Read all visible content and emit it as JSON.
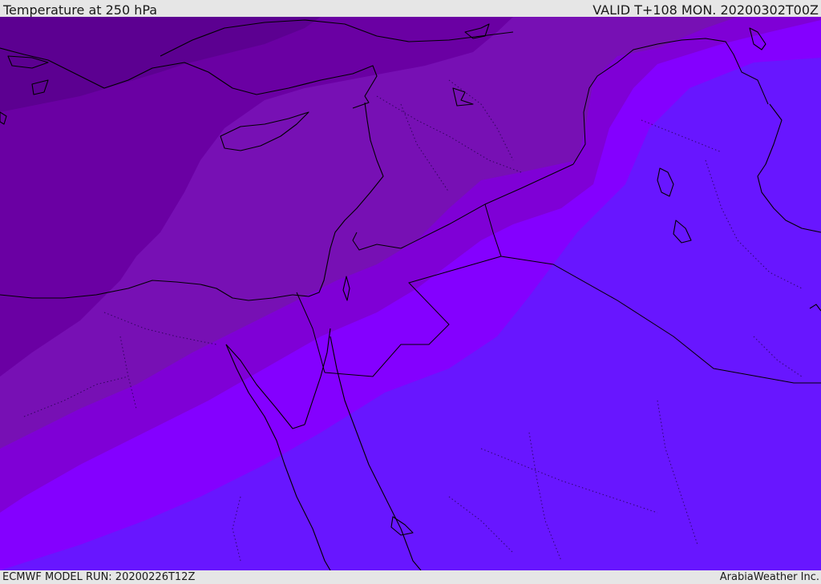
{
  "header": {
    "title": "Temperature at 250 hPa",
    "valid_time": "VALID T+108 MON. 20200302T00Z"
  },
  "footer": {
    "model_run": "ECMWF MODEL RUN: 20200226T12Z",
    "credit": "ArabiaWeather Inc."
  },
  "map": {
    "variable": "temperature",
    "pressure_level_hPa": 250,
    "region": "Eastern Mediterranean / Middle East",
    "colors": {
      "band_darkest": "#5c0091",
      "band_dark": "#6a00a3",
      "band_mid_dark": "#7710b4",
      "band_mid": "#7f00d6",
      "band_bright": "#8400ff",
      "band_blue": "#6816ff",
      "coastline": "#000000",
      "borders": "#000000"
    }
  }
}
